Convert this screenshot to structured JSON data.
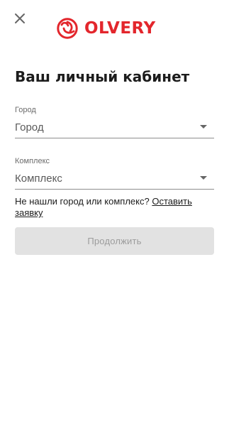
{
  "header": {
    "close_icon": "close-icon",
    "logo": {
      "icon": "olvery-logo-icon",
      "text": "OLVERY",
      "color": "#e3262c"
    }
  },
  "main": {
    "title": "Ваш личный кабинет",
    "city": {
      "label": "Город",
      "value": "Город"
    },
    "complex": {
      "label": "Комплекс",
      "value": "Комплекс"
    },
    "help": {
      "text": "Не нашли город или комплекс? ",
      "link": "Оставить заявку"
    },
    "continue_button": {
      "label": "Продолжить",
      "state": "disabled",
      "background": "#e2e2e2",
      "text_color": "#9c9c9c"
    }
  }
}
